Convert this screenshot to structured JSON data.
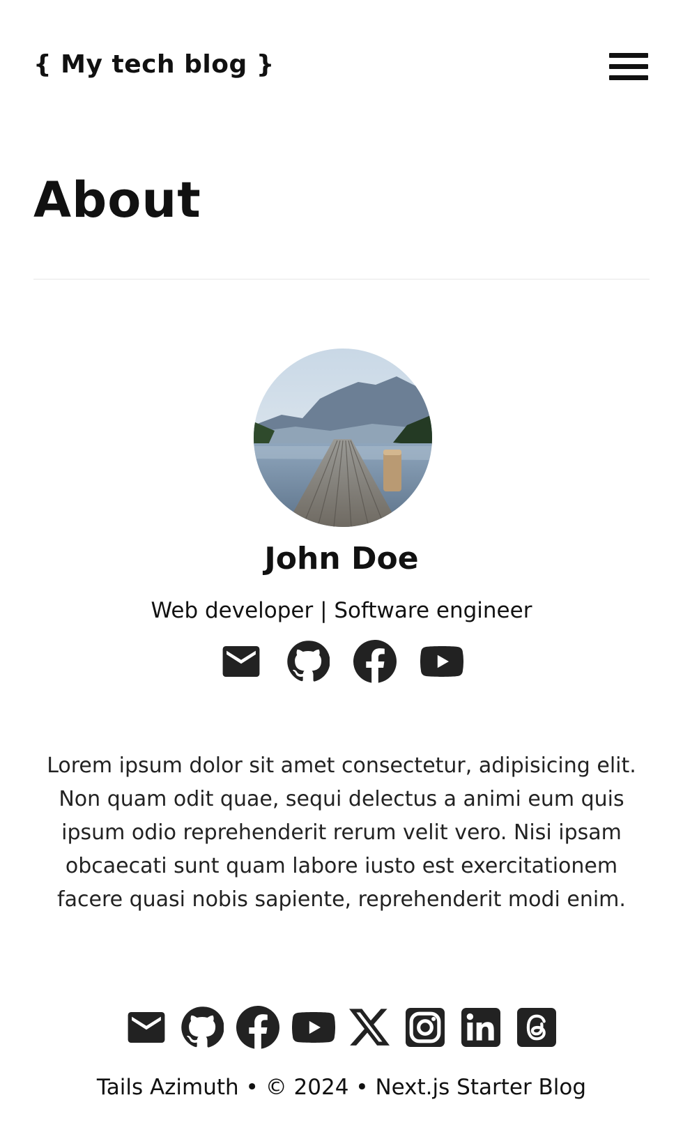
{
  "site": {
    "title": "{ My tech blog }"
  },
  "header": {
    "menu_icon": "hamburger-icon"
  },
  "page": {
    "title": "About"
  },
  "profile": {
    "name": "John Doe",
    "occupation": "Web developer | Software engineer",
    "avatar_icon": "avatar-photo-lake-pier",
    "social": [
      "mail-icon",
      "github-icon",
      "facebook-icon",
      "youtube-icon"
    ]
  },
  "bio": "Lorem ipsum dolor sit amet consectetur, adipisicing elit. Non quam odit quae, sequi delectus a animi eum quis ipsum odio reprehenderit rerum velit vero. Nisi ipsam obcaecati sunt quam labore iusto est exercitationem facere quasi nobis sapiente, reprehenderit modi enim.",
  "footer": {
    "social": [
      "mail-icon",
      "github-icon",
      "facebook-icon",
      "youtube-icon",
      "x-icon",
      "instagram-icon",
      "linkedin-icon",
      "threads-icon"
    ],
    "author": "Tails Azimuth",
    "separator": " • ",
    "copyright": "© 2024",
    "project": "Next.js Starter Blog"
  },
  "colors": {
    "text": "#111111",
    "icon": "#222222",
    "divider": "#e6e6e6",
    "background": "#ffffff"
  }
}
